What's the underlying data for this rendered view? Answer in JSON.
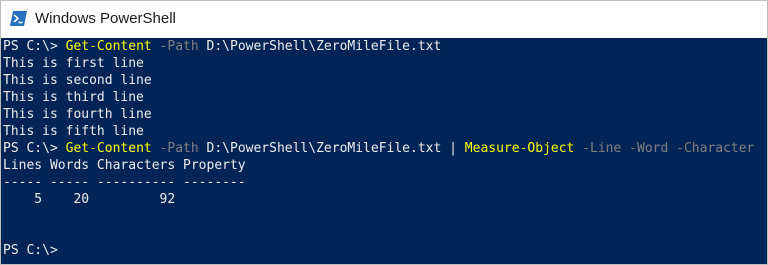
{
  "window": {
    "title": "Windows PowerShell",
    "icon": "powershell-icon"
  },
  "colors": {
    "console_bg": "#012456",
    "text": "#eeedf0",
    "command": "#ffff00",
    "parameter": "#808080"
  },
  "console": {
    "cmd1": {
      "prompt": "PS C:\\> ",
      "command": "Get-Content",
      "param": " -Path",
      "arg": " D:\\PowerShell\\ZeroMileFile.txt"
    },
    "output_lines": [
      "This is first line",
      "This is second line",
      "This is third line",
      "This is fourth line",
      "This is fifth line"
    ],
    "cmd2": {
      "prompt": "PS C:\\> ",
      "command": "Get-Content",
      "param": " -Path",
      "arg": " D:\\PowerShell\\ZeroMileFile.txt | ",
      "command2": "Measure-Object",
      "params2": " -Line -Word -Character"
    },
    "table": {
      "header": "Lines Words Characters Property",
      "separator": "----- ----- ---------- --------",
      "row": "    5    20         92"
    },
    "final_prompt": "PS C:\\>"
  }
}
